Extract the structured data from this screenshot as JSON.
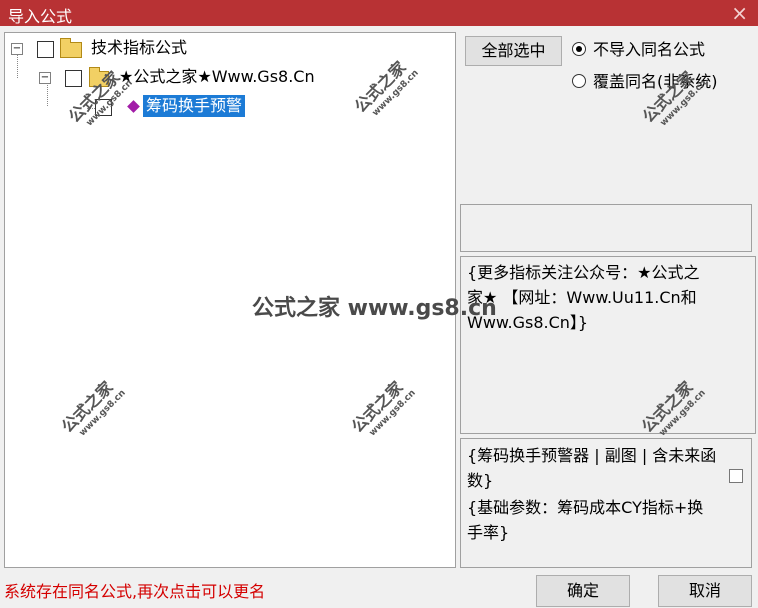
{
  "window": {
    "title": "导入公式",
    "close_glyph": "×"
  },
  "tree": {
    "root_label": "技术指标公式",
    "child_label": "★公式之家★Www.Gs8.Cn",
    "leaf_label": "筹码换手预警",
    "expander_glyph": "⊟"
  },
  "options": {
    "select_all_label": "全部选中",
    "radio1_label": "不导入同名公式",
    "radio2_label": "覆盖同名(非系统)",
    "radio1_selected": true
  },
  "info_text": "{更多指标关注公众号：★公式之家★ 【网址：Www.Uu11.Cn和Www.Gs8.Cn】}",
  "detail": {
    "line1": "{筹码换手预警器 | 副图 | 含未来函数}",
    "line2": "{基础参数：筹码成本CY指标+换手率}"
  },
  "status_text": "系统存在同名公式,再次点击可以更名",
  "buttons": {
    "ok": "确定",
    "cancel": "取消"
  },
  "watermark": {
    "big": "公式之家",
    "small": "www.gs8.cn",
    "center": "公式之家 www.gs8.cn"
  }
}
